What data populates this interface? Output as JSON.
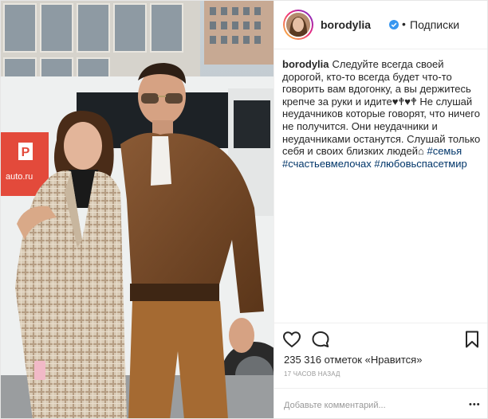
{
  "header": {
    "username": "borodylia",
    "separator": "•",
    "follow_label": "Подписки",
    "avatar_icon": "profile-avatar"
  },
  "photo": {
    "sign_letter": "P",
    "sign_text": "auto.ru"
  },
  "caption": {
    "username": "borodylia",
    "text": "Следуйте всегда своей дорогой, кто-то всегда будет что-то говорить вам вдогонку, а вы держитесь крепче за руки и идите♥︎🕈♥︎🕈 Не слушай неудачников которые говорят, что ничего не получится. Они неудачники и неудачниками останутся. Слушай только себя и своих близких людей⌂",
    "hashtags": [
      "#семья",
      "#счастьевмелочах",
      "#любовьспасетмир"
    ]
  },
  "actions": {
    "icons": [
      "heart-icon",
      "comment-bubble-icon",
      "bookmark-icon"
    ]
  },
  "likes": {
    "count": "235 316",
    "label": "отметок",
    "like_link": "«Нравится»"
  },
  "time": {
    "ago": "17 часов назад"
  },
  "comment": {
    "placeholder": "Добавьте комментарий...",
    "more": "•••"
  },
  "colors": {
    "verified": "#3897f0",
    "hashtag": "#003569",
    "border": "#efefef",
    "muted": "#999999"
  }
}
